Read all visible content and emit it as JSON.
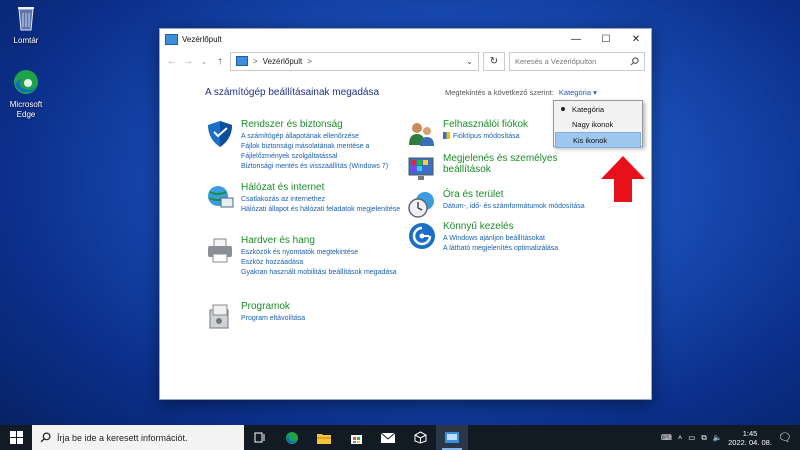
{
  "desktop": {
    "icons": [
      {
        "label": "Lomtár",
        "icon": "recycle-bin-icon"
      },
      {
        "label": "Microsoft Edge",
        "icon": "edge-icon"
      }
    ]
  },
  "window": {
    "title": "Vezérlőpult",
    "address": {
      "crumb": "Vezérlőpult",
      "separator": ">"
    },
    "search_placeholder": "Keresés a Vezérlőpulton",
    "page_title": "A számítógép beállításainak megadása",
    "view_by": {
      "label": "Megtekintés a következő szerint:",
      "value": "Kategória"
    },
    "view_menu": {
      "items": [
        "Kategória",
        "Nagy ikonok",
        "Kis ikonok"
      ],
      "checked": "Kategória",
      "highlighted": "Kis ikonok"
    },
    "categories_left": [
      {
        "title": "Rendszer és biztonság",
        "icon": "shield-icon",
        "links": [
          "A számítógép állapotának ellenőrzése",
          "Fájlok biztonsági másolatának mentése a Fájlelőzmények szolgáltatással",
          "Biztonsági mentés és visszaállítás (Windows 7)"
        ]
      },
      {
        "title": "Hálózat és internet",
        "icon": "network-globe-icon",
        "links": [
          "Csatlakozás az internethez",
          "Hálózati állapot és hálózati feladatok megjelenítése"
        ]
      },
      {
        "title": "Hardver és hang",
        "icon": "printer-icon",
        "links": [
          "Eszközök és nyomtatók megtekintése",
          "Eszköz hozzáadása",
          "Gyakran használt mobilitási beállítások megadása"
        ]
      },
      {
        "title": "Programok",
        "icon": "programs-icon",
        "links": [
          "Program eltávolítása"
        ]
      }
    ],
    "categories_right": [
      {
        "title": "Felhasználói fiókok",
        "icon": "users-icon",
        "links": [
          "Fióktípus módosítása"
        ]
      },
      {
        "title": "Megjelenés és személyes beállítások",
        "icon": "appearance-icon",
        "links": []
      },
      {
        "title": "Óra és terület",
        "icon": "clock-globe-icon",
        "links": [
          "Dátum-, idő- és számformátumok módosítása"
        ]
      },
      {
        "title": "Könnyű kezelés",
        "icon": "ease-of-access-icon",
        "links": [
          "A Windows ajánljon beállításokat",
          "A látható megjelenítés optimalizálása"
        ]
      }
    ]
  },
  "taskbar": {
    "search_placeholder": "Írja be ide a keresett információt.",
    "time": "1:45",
    "date": "2022. 04. 08."
  },
  "colors": {
    "accent_arrow": "#e8111a",
    "link": "#1a5fb4",
    "category_title": "#1c8d2a"
  }
}
